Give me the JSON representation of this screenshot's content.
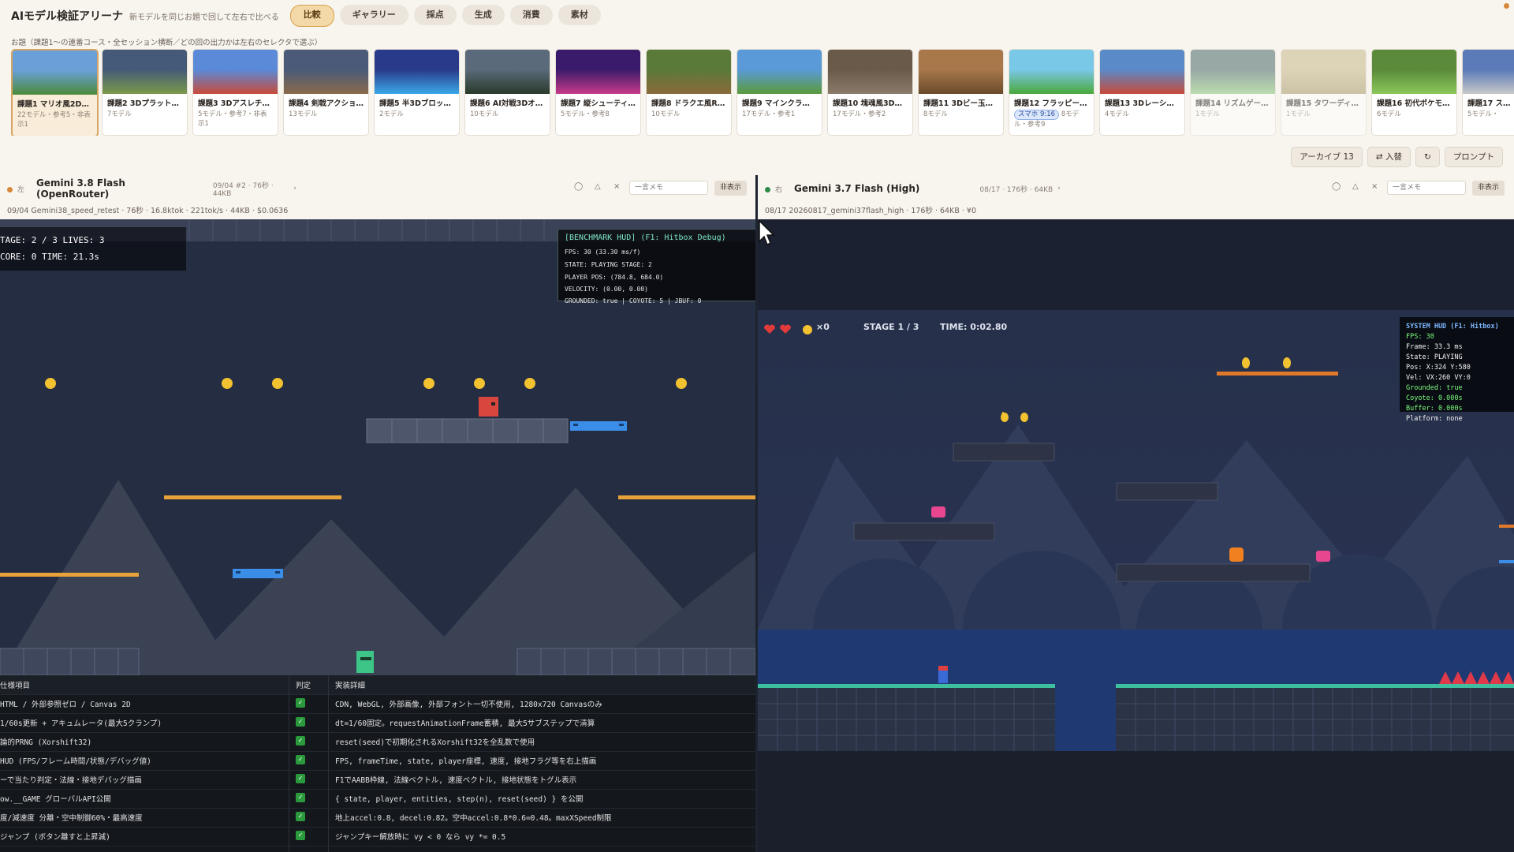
{
  "app": {
    "title": "AIモデル検証アリーナ",
    "subtitle": "新モデルを同じお題で回して左右で比べる",
    "nav": [
      "比較",
      "ギャラリー",
      "採点",
      "生成",
      "消費",
      "素材"
    ],
    "nav_active": "比較"
  },
  "prompt_line": "お題（課題1〜の連番コース・全セッション横断／どの回の出力かは左右のセレクタで選ぶ）",
  "tasks": [
    {
      "title": "課題1 マリオ風2D…",
      "meta": "22モデル・参考5・非表示1",
      "selected": true
    },
    {
      "title": "課題2 3Dプラット…",
      "meta": "7モデル"
    },
    {
      "title": "課題3 3Dアスレチ…",
      "meta": "5モデル・参考7・非表示1"
    },
    {
      "title": "課題4 剣戟アクショ…",
      "meta": "13モデル"
    },
    {
      "title": "課題5 半3Dブロッ…",
      "meta": "2モデル"
    },
    {
      "title": "課題6 AI対戦3Dオ…",
      "meta": "10モデル"
    },
    {
      "title": "課題7 縦シューティ…",
      "meta": "5モデル・参考8"
    },
    {
      "title": "課題8 ドラクエ風R…",
      "meta": "10モデル"
    },
    {
      "title": "課題9 マインクラフ…",
      "meta": "17モデル・参考1"
    },
    {
      "title": "課題10 塊魂風3Dア…",
      "meta": "17モデル・参考2"
    },
    {
      "title": "課題11 3Dビー玉コ…",
      "meta": "8モデル"
    },
    {
      "title": "課題12 フラッピー…",
      "badge": "スマホ 9:16",
      "meta": "8モデル・参考9"
    },
    {
      "title": "課題13 3Dレーシン…",
      "meta": "4モデル"
    },
    {
      "title": "課題14 リズムゲー…",
      "meta": "1モデル",
      "dim": true
    },
    {
      "title": "課題15 タワーディ…",
      "meta": "1モデル",
      "dim": true
    },
    {
      "title": "課題16 初代ポケモ…",
      "meta": "6モデル"
    },
    {
      "title": "課題17 ス…",
      "meta": "5モデル・"
    }
  ],
  "actions": {
    "archive": "アーカイブ 13",
    "swap": "⇄ 入替",
    "refresh": "↻",
    "prompt": "プロンプト"
  },
  "left": {
    "side": "左",
    "model": "Gemini 3.8 Flash (OpenRouter)",
    "model_meta": "09/04 #2 · 76秒 · 44KB",
    "memo_placeholder": "一言メモ",
    "hide": "非表示",
    "subline": "09/04 Gemini38_speed_retest · 76秒 · 16.8ktok · 221tok/s · 44KB · $0.0636",
    "hud": {
      "line1": "TAGE: 2 / 3    LIVES: 3",
      "line2": "CORE: 0    TIME: 21.3s"
    },
    "bench_title": "[BENCHMARK HUD] (F1: Hitbox Debug)",
    "bench_lines": [
      "FPS: 30  (33.30 ms/f)",
      "STATE: PLAYING   STAGE: 2",
      "PLAYER POS: (784.8, 684.0)",
      "VELOCITY: (0.00, 0.00)",
      "GROUNDED: true | COYOTE: 5 | JBUF: 0"
    ]
  },
  "right": {
    "side": "右",
    "model": "Gemini 3.7 Flash (High)",
    "model_meta": "08/17 · 176秒 · 64KB",
    "memo_placeholder": "一言メモ",
    "hide": "非表示",
    "subline": "08/17 20260817_gemini37flash_high · 176秒 · 64KB · ¥0",
    "hud": {
      "coins": "×0",
      "stage": "STAGE 1 / 3",
      "time": "TIME: 0:02.80"
    },
    "sys_title": "SYSTEM HUD (F1: Hitbox)",
    "sys_lines": [
      "FPS: 30",
      "Frame: 33.3 ms",
      "State: PLAYING",
      "Pos: X:324 Y:580",
      "Vel: VX:260 VY:0",
      "Grounded: true",
      "Coyote: 0.000s",
      "Buffer: 0.000s",
      "Platform: none"
    ]
  },
  "spec": {
    "headers": [
      "仕様項目",
      "判定",
      "実装詳細"
    ],
    "rows": [
      [
        "HTML / 外部参照ゼロ / Canvas 2D",
        "CDN, WebGL, 外部画像, 外部フォント一切不使用, 1280x720 Canvasのみ"
      ],
      [
        "1/60s更新 + アキュムレータ(最大5クランプ)",
        "dt=1/60固定。requestAnimationFrame蓄積, 最大5サブステップで清算"
      ],
      [
        "論的PRNG (Xorshift32)",
        "reset(seed)で初期化されるXorshift32を全乱数で使用"
      ],
      [
        "HUD (FPS/フレーム時間/状態/デバッグ値)",
        "FPS, frameTime, state, player座標, 速度, 接地フラグ等を右上描画"
      ],
      [
        "ーで当たり判定・法線・接地デバッグ描画",
        "F1でAABB枠線, 法線ベクトル, 速度ベクトル, 接地状態をトグル表示"
      ],
      [
        "ow.__GAME グローバルAPI公開",
        "{ state, player, entities, step(n), reset(seed) } を公開"
      ],
      [
        "度/減速度 分離・空中制御60%・最高速度",
        "地上accel:0.8, decel:0.82。空中accel:0.8*0.6=0.48。maxXSpeed制限"
      ],
      [
        "ジャンプ (ボタン離すと上昇減)",
        "ジャンプキー解放時に vy < 0 なら vy *= 0.5"
      ]
    ]
  },
  "colors": {
    "accent": "#d4a04b",
    "left_dot": "#d6883a",
    "right_dot": "#2f8a4a",
    "coin": "#f2c230",
    "hud_green": "#7dff7d"
  }
}
